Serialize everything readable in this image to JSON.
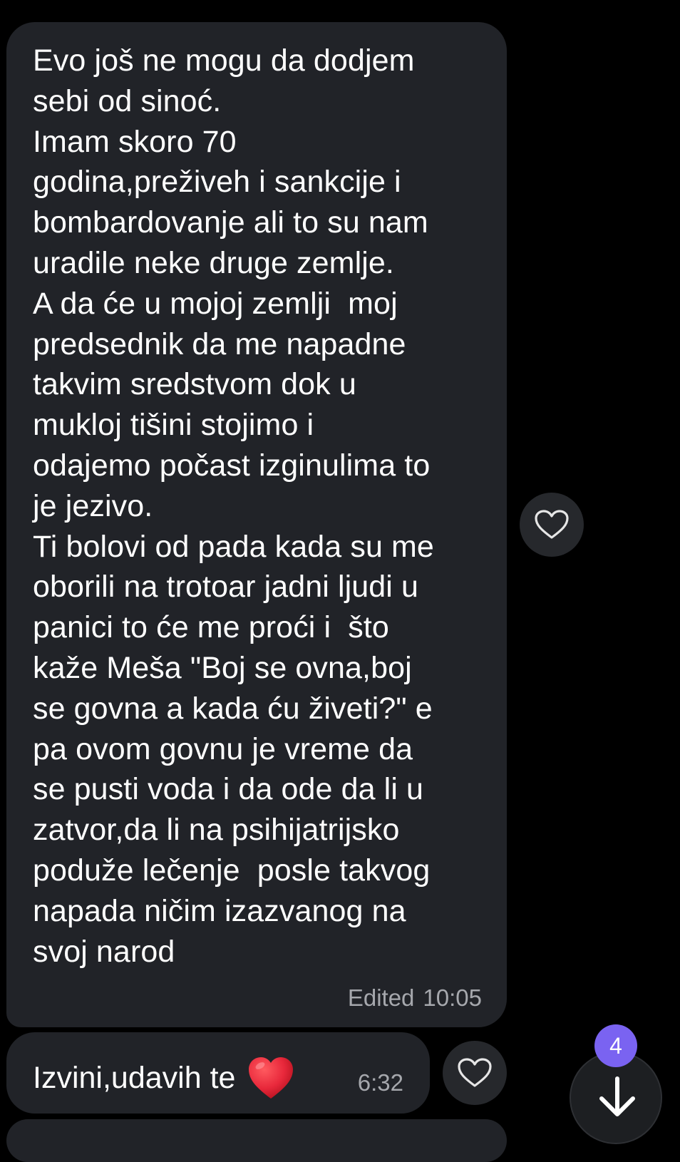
{
  "messages": [
    {
      "text": "Evo još ne mogu da dodjem\nsebi od sinoć.\nImam skoro 70\ngodina,preživeh i sankcije i\nbombardovanje ali to su nam\nuradile neke druge zemlje.\nA da će u mojoj zemlji  moj\npredsednik da me napadne\ntakvim sredstvom dok u\nmukloj tišini stojimo i\nodajemo počast izginulima to\nje jezivo.\nTi bolovi od pada kada su me\noborili na trotoar jadni ljudi u\npanici to će me proći i  što\nkaže Meša \"Boj se ovna,boj\nse govna a kada ću živeti?\" e\npa ovom govnu je vreme da\nse pusti voda i da ode da li u\nzatvor,da li na psihijatrijsko\npoduže lečenje  posle takvog\nnapada ničim izazvanog na\nsvoj narod",
      "status": "Edited",
      "time": "10:05"
    },
    {
      "text": "Izvini,udavih te",
      "emoji": "red-heart-emoji",
      "time": "6:32"
    }
  ],
  "scroll_button": {
    "unread_count": "4",
    "icon": "arrow-down-icon"
  },
  "reaction_icon": "heart-outline-icon",
  "colors": {
    "background": "#000000",
    "bubble": "#212328",
    "meta_text": "#a6a8ad",
    "badge": "#7a63f1",
    "emoji_heart": "#e8283b"
  }
}
